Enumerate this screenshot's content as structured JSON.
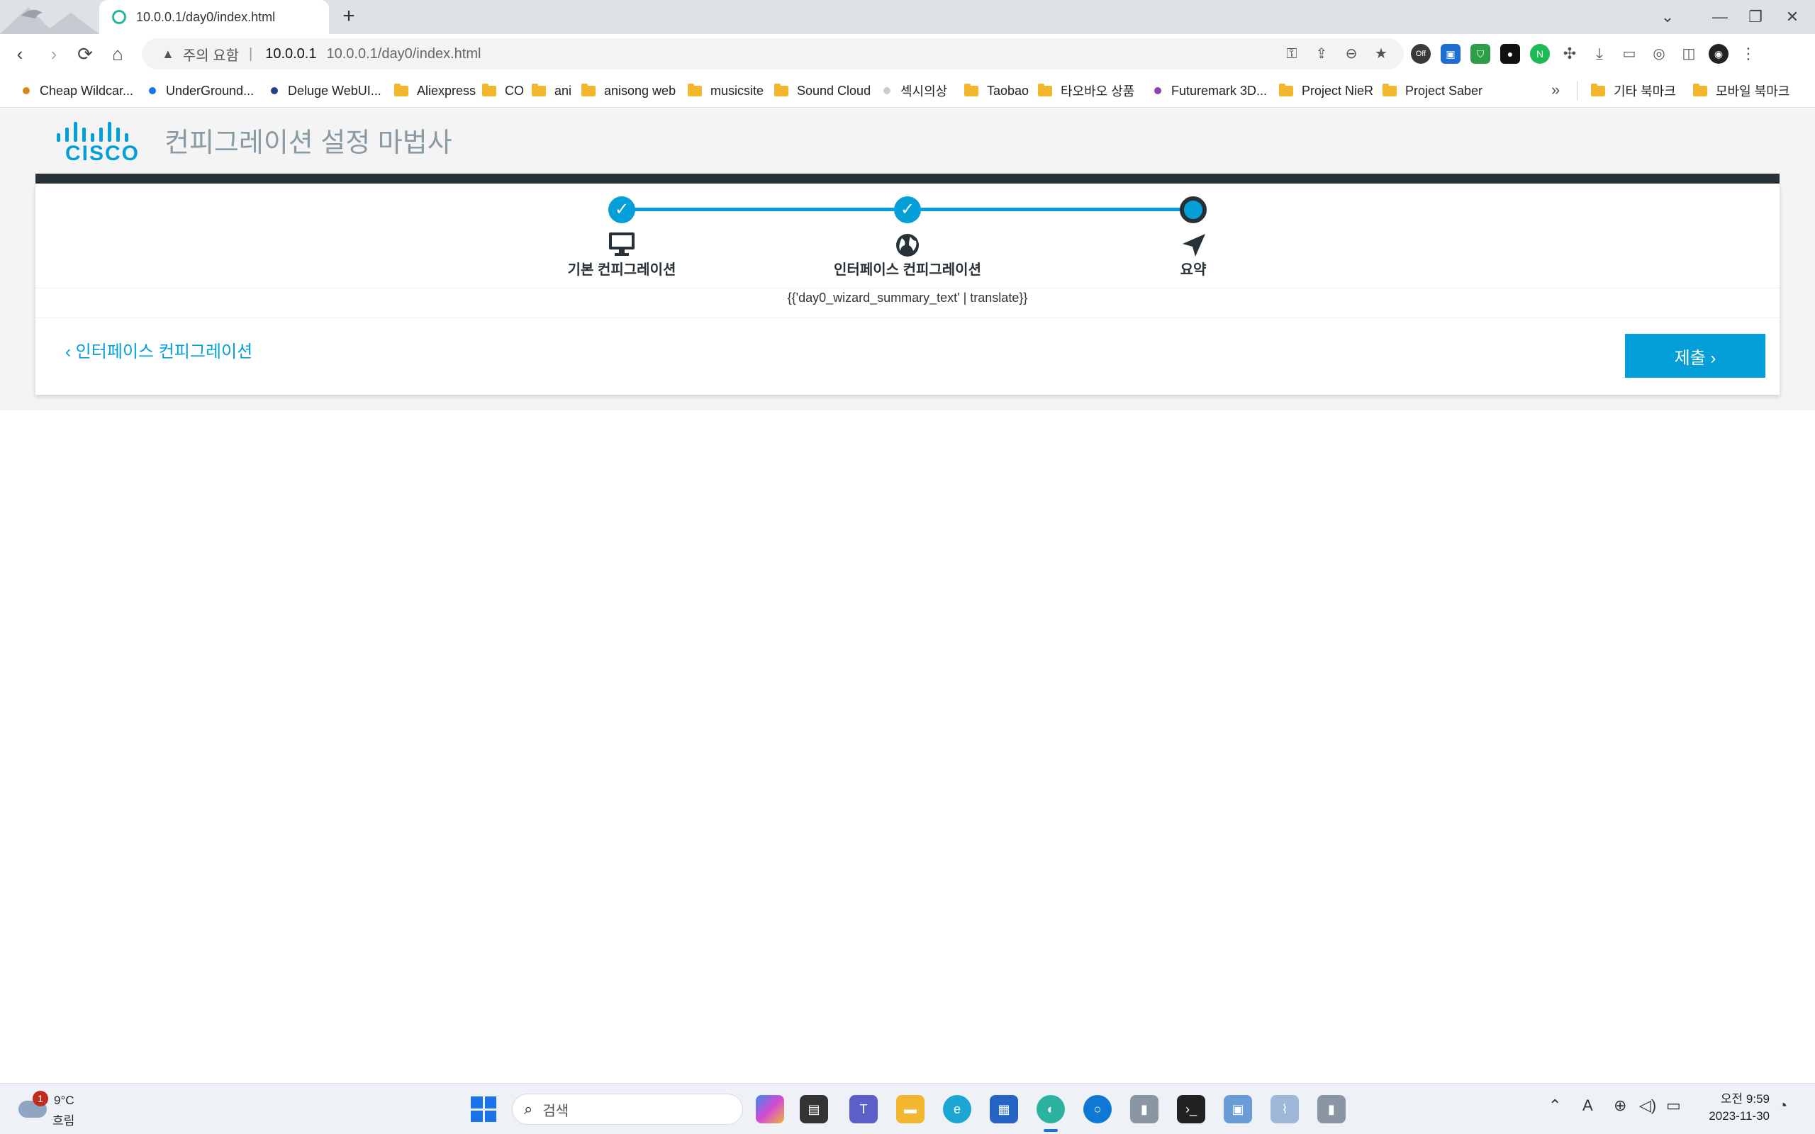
{
  "browser": {
    "tab_title": "10.0.0.1/day0/index.html",
    "new_tab": "+",
    "window_controls": {
      "list": "⌄",
      "minimize": "—",
      "restore": "❐",
      "close": "✕"
    },
    "nav": {
      "back": "‹",
      "forward": "›",
      "reload": "⟳",
      "home": "⌂"
    },
    "address": {
      "security_label": "주의 요함",
      "separator": "|",
      "host": "10.0.0.1",
      "url": "10.0.0.1/day0/index.html"
    },
    "omnibox_icons": [
      "key-icon",
      "share-icon",
      "zoom-out-icon",
      "favorites-icon"
    ],
    "extension_off_label": "Off"
  },
  "bookmarks": {
    "items": [
      {
        "label": "Cheap Wildcar...",
        "icon": "dot",
        "color": "#d68a1e"
      },
      {
        "label": "UnderGround...",
        "icon": "dot",
        "color": "#1a73e8"
      },
      {
        "label": "Deluge WebUI...",
        "icon": "dot",
        "color": "#24408e"
      },
      {
        "label": "Aliexpress",
        "icon": "folder"
      },
      {
        "label": "CO",
        "icon": "folder"
      },
      {
        "label": "ani",
        "icon": "folder"
      },
      {
        "label": "anisong web",
        "icon": "folder"
      },
      {
        "label": "musicsite",
        "icon": "folder"
      },
      {
        "label": "Sound Cloud",
        "icon": "folder"
      },
      {
        "label": "섹시의상",
        "icon": "dot",
        "color": "#cccccc"
      },
      {
        "label": "Taobao",
        "icon": "folder"
      },
      {
        "label": "타오바오 상품",
        "icon": "folder"
      },
      {
        "label": "Futuremark 3D...",
        "icon": "dot",
        "color": "#8e44ad"
      },
      {
        "label": "Project NieR",
        "icon": "folder"
      },
      {
        "label": "Project Saber",
        "icon": "folder"
      }
    ],
    "more": "»",
    "other_bookmarks": "기타 북마크",
    "mobile_bookmarks": "모바일 북마크"
  },
  "page": {
    "logo_text": "CISCO",
    "title": "컨피그레이션 설정 마법사",
    "steps": [
      {
        "label": "기본 컨피그레이션",
        "state": "complete",
        "icon": "monitor-icon"
      },
      {
        "label": "인터페이스 컨피그레이션",
        "state": "complete",
        "icon": "globe-icon"
      },
      {
        "label": "요약",
        "state": "current",
        "icon": "location-arrow-icon"
      }
    ],
    "check_glyph": "✓",
    "summary_text": "{{'day0_wizard_summary_text' | translate}}",
    "back_link": "‹ 인터페이스 컨피그레이션",
    "submit_label": "제출 ›"
  },
  "taskbar": {
    "weather": {
      "temp": "9°C",
      "condition": "흐림",
      "badge": "1"
    },
    "search_placeholder": "검색",
    "clock": {
      "time": "오전 9:59",
      "date": "2023-11-30"
    },
    "tray_icons": [
      "chevron-up-icon",
      "ime-icon",
      "network-icon",
      "volume-icon",
      "battery-icon",
      "notification-icon"
    ],
    "ime_label": "A"
  },
  "colors": {
    "accent": "#049fd9",
    "dark_bar": "#263238",
    "title_gray": "#8a9aa5"
  }
}
